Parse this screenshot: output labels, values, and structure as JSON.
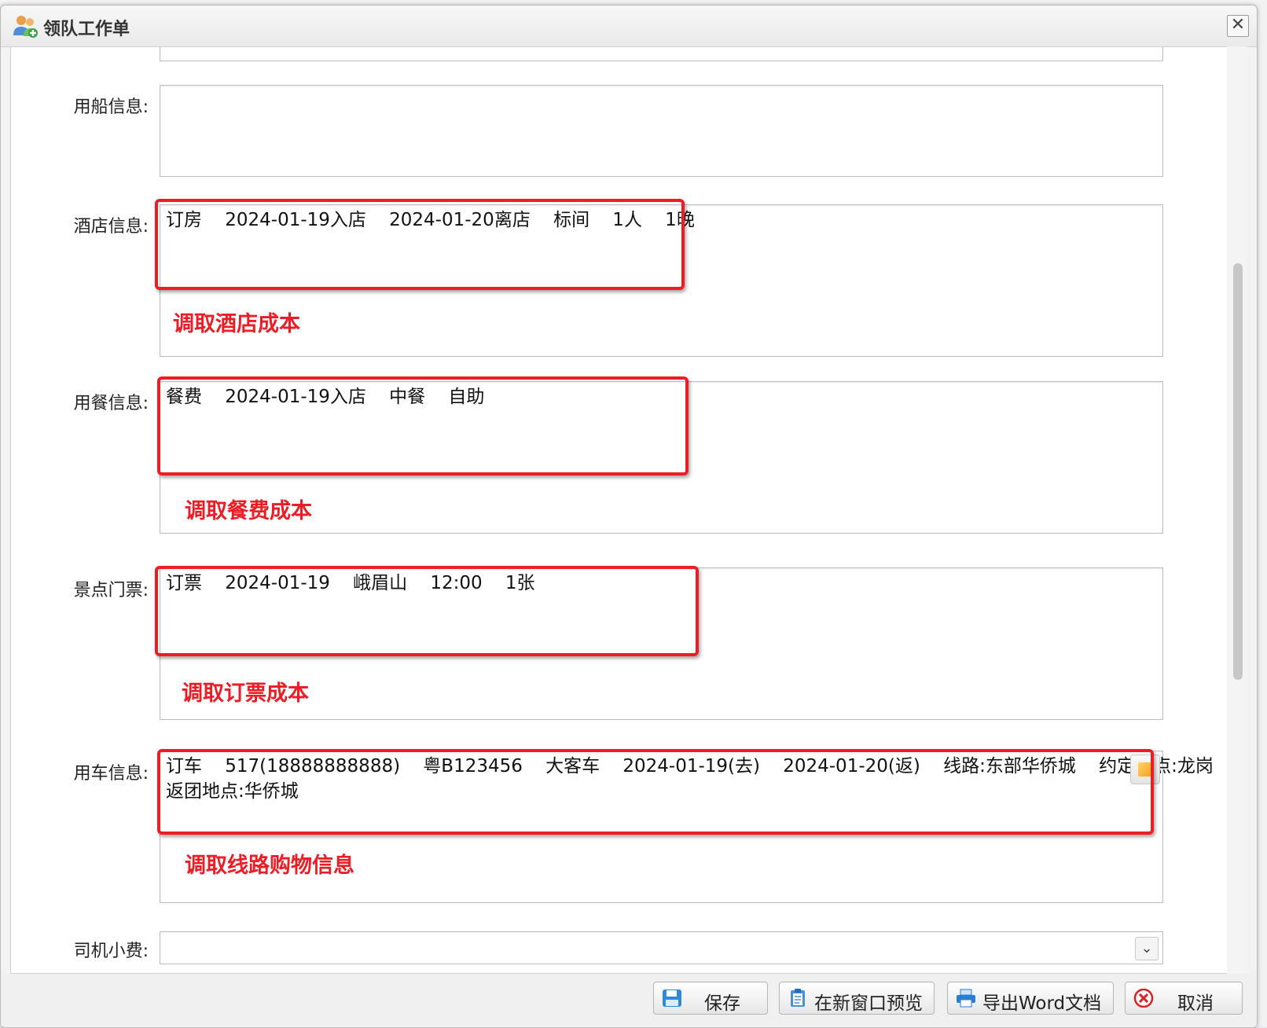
{
  "window": {
    "title": "领队工作单",
    "close_glyph": "✕"
  },
  "fields": {
    "boat": {
      "label": "用船信息:",
      "value": ""
    },
    "hotel": {
      "label": "酒店信息:",
      "value": "订房    2024-01-19入店    2024-01-20离店    标间    1人    1晚",
      "annotation": "调取酒店成本"
    },
    "meal": {
      "label": "用餐信息:",
      "value": "餐费    2024-01-19入店    中餐    自助",
      "annotation": "调取餐费成本"
    },
    "ticket": {
      "label": "景点门票:",
      "value": "订票    2024-01-19    峨眉山    12:00    1张",
      "annotation": "调取订票成本"
    },
    "vehicle": {
      "label": "用车信息:",
      "value_line1": "订车    517(18888888888)    粤B123456    大客车    2024-01-19(去)    2024-01-20(返)    线路:东部华侨城    约定地点:龙岗",
      "value_line2": "返团地点:华侨城",
      "annotation": "调取线路购物信息"
    },
    "driver_tip": {
      "label": "司机小费:",
      "value": ""
    }
  },
  "footer": {
    "save": "保存",
    "preview": "在新窗口预览",
    "export": "导出Word文档",
    "cancel": "取消"
  },
  "colors": {
    "annotation_red": "#ee1c25"
  },
  "icons": {
    "title": "users-icon",
    "save": "floppy-icon",
    "preview": "clipboard-icon",
    "export": "printer-icon",
    "cancel": "cancel-circle-icon",
    "picker": "picker-icon"
  }
}
